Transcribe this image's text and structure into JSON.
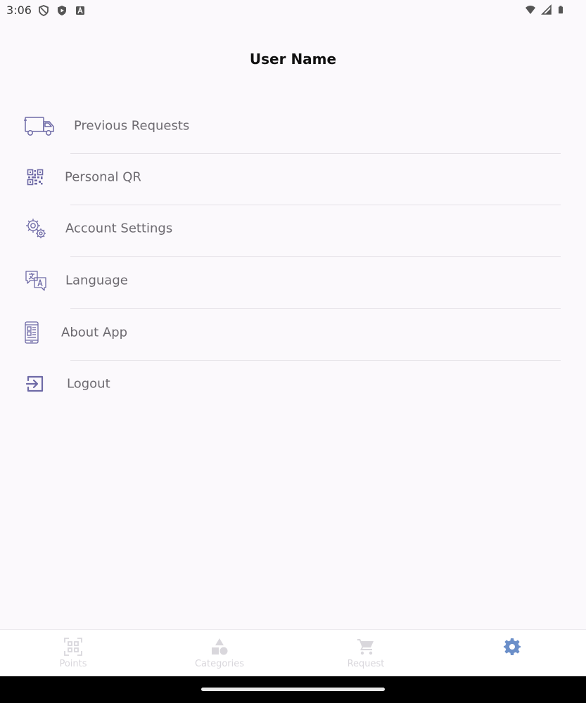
{
  "status_bar": {
    "time": "3:06",
    "left_icons": [
      "shield-icon",
      "play-protect-icon",
      "a-badge-icon"
    ],
    "right_icons": [
      "wifi-icon",
      "signal-icon",
      "battery-icon"
    ]
  },
  "header": {
    "title": "User Name"
  },
  "menu": {
    "items": [
      {
        "label": "Previous Requests",
        "icon": "truck-icon"
      },
      {
        "label": "Personal QR",
        "icon": "qr-code-icon"
      },
      {
        "label": "Account Settings",
        "icon": "gears-icon"
      },
      {
        "label": "Language",
        "icon": "language-icon"
      },
      {
        "label": "About App",
        "icon": "about-app-icon"
      },
      {
        "label": "Logout",
        "icon": "logout-icon"
      }
    ]
  },
  "bottom_nav": {
    "tabs": [
      {
        "label": "Points",
        "icon": "qr-scan-icon",
        "active": false
      },
      {
        "label": "Categories",
        "icon": "categories-icon",
        "active": false
      },
      {
        "label": "Request",
        "icon": "cart-icon",
        "active": false
      },
      {
        "label": "",
        "icon": "settings-gear-icon",
        "active": true
      }
    ]
  },
  "colors": {
    "accent": "#6b8fc9",
    "icon": "#6e6aa6",
    "label": "#6d6a70",
    "inactive": "#d9d7dc",
    "background": "#fbf9fc"
  }
}
